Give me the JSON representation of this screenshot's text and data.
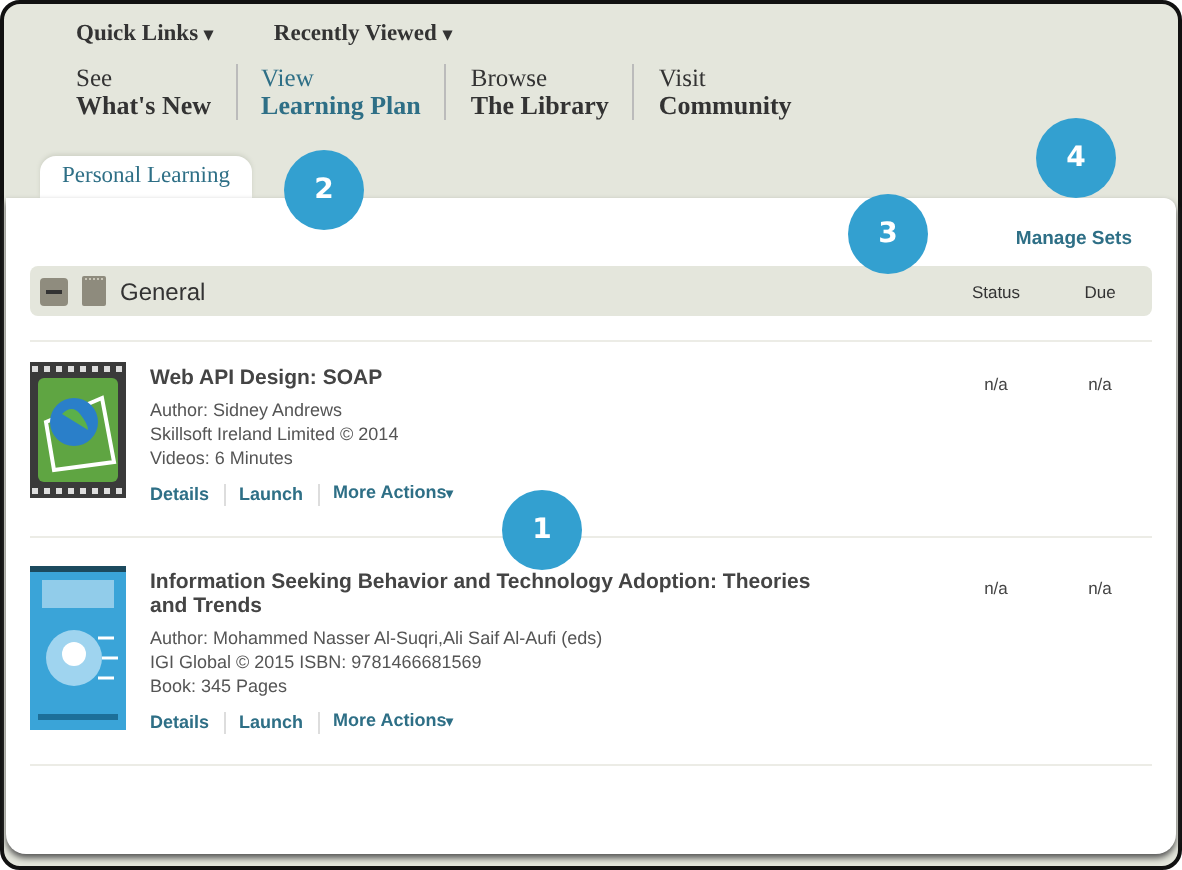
{
  "header": {
    "menus": [
      {
        "label": "Quick Links",
        "caret": "▾"
      },
      {
        "label": "Recently Viewed",
        "caret": "▾"
      }
    ],
    "nav": [
      {
        "top": "See",
        "bottom": "What's New",
        "selected": false
      },
      {
        "top": "View",
        "bottom": "Learning Plan",
        "selected": true
      },
      {
        "top": "Browse",
        "bottom": "The Library",
        "selected": false
      },
      {
        "top": "Visit",
        "bottom": "Community",
        "selected": false
      }
    ]
  },
  "tabs": [
    {
      "label": "Personal Learning",
      "selected": true
    }
  ],
  "manage_sets": "Manage Sets",
  "group": {
    "title": "General",
    "expanded": true,
    "columns": [
      "Status",
      "Due"
    ]
  },
  "items": [
    {
      "kind": "video",
      "title": "Web API Design: SOAP",
      "details": [
        "Author: Sidney Andrews",
        "Skillsoft Ireland Limited © 2014",
        "Videos: 6 Minutes"
      ],
      "actions": [
        "Details",
        "Launch",
        "More Actions"
      ],
      "caret": "▾",
      "status": "n/a",
      "due": "n/a"
    },
    {
      "kind": "book",
      "title": "Information Seeking Behavior and Technology Adoption: Theories and Trends",
      "details": [
        "Author: Mohammed Nasser Al-Suqri,Ali Saif Al-Aufi (eds)",
        "IGI Global © 2015 ISBN: 9781466681569",
        "Book: 345 Pages"
      ],
      "actions": [
        "Details",
        "Launch",
        "More Actions"
      ],
      "caret": "▾",
      "status": "n/a",
      "due": "n/a"
    }
  ],
  "callouts": [
    {
      "label": "1"
    },
    {
      "label": "2"
    },
    {
      "label": "3"
    },
    {
      "label": "4"
    }
  ]
}
